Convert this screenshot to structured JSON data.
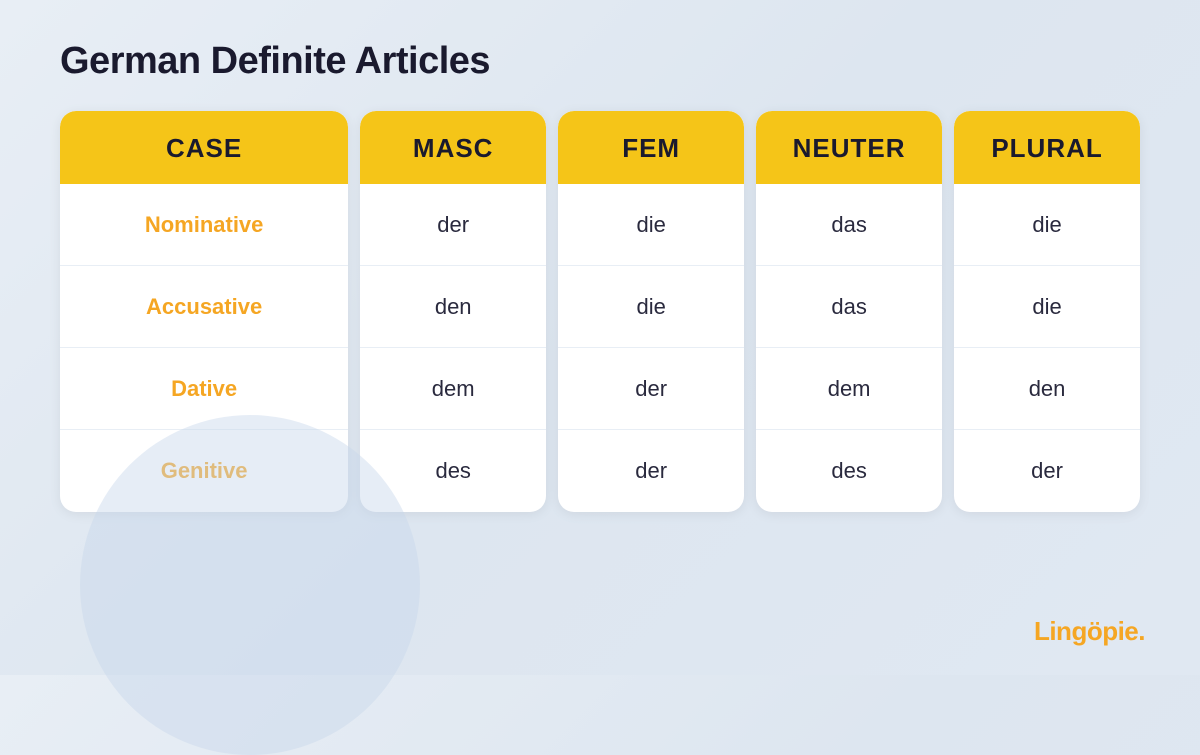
{
  "page": {
    "title": "German Definite Articles",
    "brand": "Lingöpie."
  },
  "columns": [
    {
      "id": "case",
      "header": "CASE",
      "cells": [
        "Nominative",
        "Accusative",
        "Dative",
        "Genitive"
      ],
      "type": "case"
    },
    {
      "id": "masc",
      "header": "MASC",
      "cells": [
        "der",
        "den",
        "dem",
        "des"
      ],
      "type": "value"
    },
    {
      "id": "fem",
      "header": "FEM",
      "cells": [
        "die",
        "die",
        "der",
        "der"
      ],
      "type": "value"
    },
    {
      "id": "neuter",
      "header": "NEUTER",
      "cells": [
        "das",
        "das",
        "dem",
        "des"
      ],
      "type": "value"
    },
    {
      "id": "plural",
      "header": "PLURAL",
      "cells": [
        "die",
        "die",
        "den",
        "der"
      ],
      "type": "value"
    }
  ]
}
